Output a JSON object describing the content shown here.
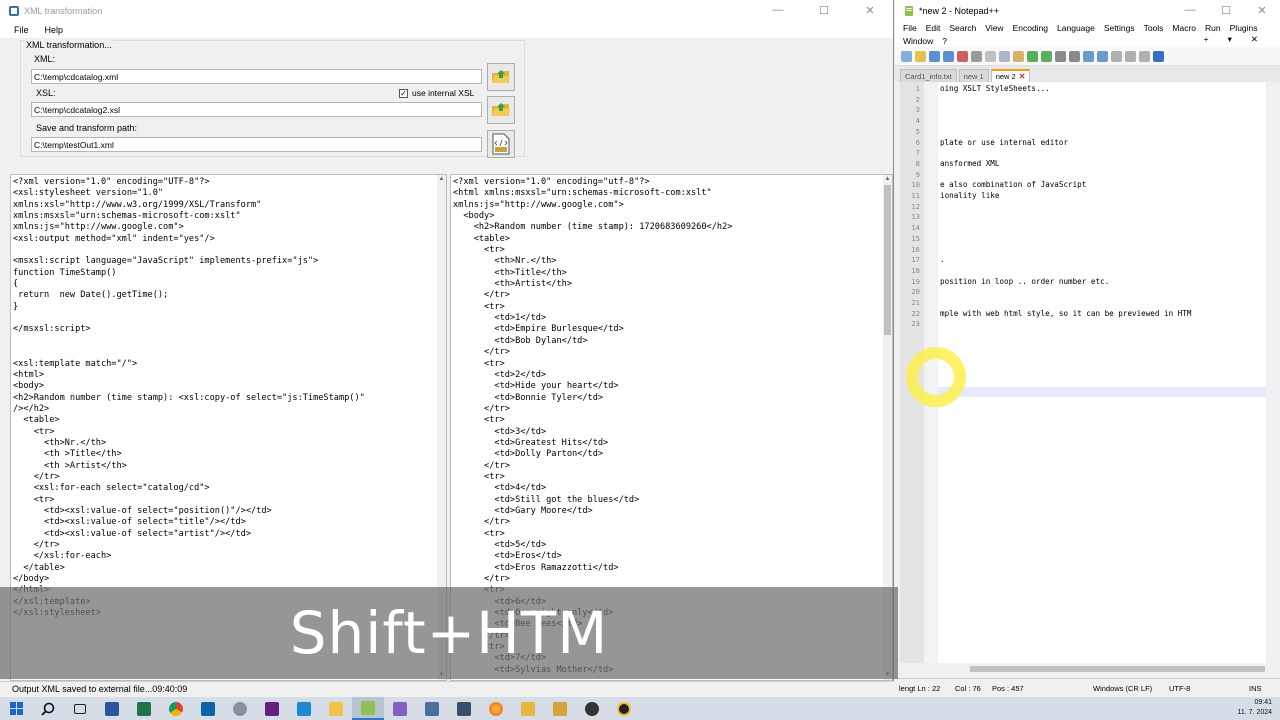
{
  "xml_window": {
    "title": "XML transformation",
    "menu": [
      "File",
      "Help"
    ],
    "group_title": "XML transformation...",
    "xml_label": "XML:",
    "xml_value": "C:\\temp\\cdcatalog.xml",
    "xsl_label": "XSL:",
    "xsl_value": "C:\\temp\\cdcatalog2.xsl",
    "use_internal_label": "use internal XSL",
    "use_internal_checked": true,
    "save_label": "Save and transform path:",
    "save_value": "C:\\temp\\testOut1.xml",
    "xsl_source": "<?xml version=\"1.0\" encoding=\"UTF-8\"?>\n<xsl:stylesheet version=\"1.0\"\nxmlns:xsl=\"http://www.w3.org/1999/XSL/Transform\"\nxmlns:msxsl=\"urn:schemas-microsoft-com:xslt\"\nxmlns:js=\"http://www.google.com\">\n<xsl:output method=\"xml\" indent=\"yes\"/>\n\n<msxsl:script language=\"JavaScript\" implements-prefix=\"js\">\nfunction TimeStamp()\n{\n return  new Date().getTime();\n}\n\n</msxsl:script>\n\n\n<xsl:template match=\"/\">\n<html>\n<body>\n<h2>Random number (time stamp): <xsl:copy-of select=\"js:TimeStamp()\"\n/></h2>\n  <table>\n    <tr>\n      <th>Nr.</th>\n      <th >Title</th>\n      <th >Artist</th>\n    </tr>\n    <xsl:for-each select=\"catalog/cd\">\n    <tr>\n      <td><xsl:value-of select=\"position()\"/></td>\n      <td><xsl:value-of select=\"title\"/></td>\n      <td><xsl:value-of select=\"artist\"/></td>\n    </tr>\n    </xsl:for-each>\n  </table>\n</body>\n</html>\n</xsl:template>\n</xsl:stylesheet>",
    "output_source": "<?xml version=\"1.0\" encoding=\"utf-8\"?>\n<html xmlns:msxsl=\"urn:schemas-microsoft-com:xslt\"\nxmlns:js=\"http://www.google.com\">\n  <body>\n    <h2>Random number (time stamp): 1720683609260</h2>\n    <table>\n      <tr>\n        <th>Nr.</th>\n        <th>Title</th>\n        <th>Artist</th>\n      </tr>\n      <tr>\n        <td>1</td>\n        <td>Empire Burlesque</td>\n        <td>Bob Dylan</td>\n      </tr>\n      <tr>\n        <td>2</td>\n        <td>Hide your heart</td>\n        <td>Bonnie Tyler</td>\n      </tr>\n      <tr>\n        <td>3</td>\n        <td>Greatest Hits</td>\n        <td>Dolly Parton</td>\n      </tr>\n      <tr>\n        <td>4</td>\n        <td>Still got the blues</td>\n        <td>Gary Moore</td>\n      </tr>\n      <tr>\n        <td>5</td>\n        <td>Eros</td>\n        <td>Eros Ramazzotti</td>\n      </tr>\n      <tr>\n        <td>6</td>\n        <td>One night only</td>\n        <td>Bee Gees</td>\n      </tr>\n      <tr>\n        <td>7</td>\n        <td>Sylvias Mother</td>",
    "status": "Output XML saved to external file...09:40:09"
  },
  "notepad": {
    "title": "*new 2 - Notepad++",
    "menu_row1": [
      "File",
      "Edit",
      "Search",
      "View",
      "Encoding",
      "Language",
      "Settings",
      "Tools",
      "Macro",
      "Run",
      "Plugins"
    ],
    "menu_row2": [
      "Window",
      "?"
    ],
    "menu_right": [
      "+",
      "▾",
      "✕"
    ],
    "tabs": [
      {
        "label": "Card1_info.txt",
        "active": false
      },
      {
        "label": "new 1",
        "active": false
      },
      {
        "label": "new 2",
        "active": true
      }
    ],
    "lines": [
      {
        "n": "1",
        "t": "oing XSLT StyleSheets..."
      },
      {
        "n": "2",
        "t": ""
      },
      {
        "n": "3",
        "t": ""
      },
      {
        "n": "4",
        "t": ""
      },
      {
        "n": "5",
        "t": ""
      },
      {
        "n": "6",
        "t": "plate or use internal editor"
      },
      {
        "n": "7",
        "t": ""
      },
      {
        "n": "8",
        "t": "ansformed XML"
      },
      {
        "n": "9",
        "t": ""
      },
      {
        "n": "10",
        "t": "e also combination of JavaScript"
      },
      {
        "n": "11",
        "t": "ionality like"
      },
      {
        "n": "12",
        "t": ""
      },
      {
        "n": "13",
        "t": ""
      },
      {
        "n": "14",
        "t": ""
      },
      {
        "n": "15",
        "t": ""
      },
      {
        "n": "16",
        "t": ""
      },
      {
        "n": "17",
        "t": "."
      },
      {
        "n": "18",
        "t": ""
      },
      {
        "n": "19",
        "t": "position in loop .. order number etc."
      },
      {
        "n": "20",
        "t": ""
      },
      {
        "n": "21",
        "t": ""
      },
      {
        "n": "22",
        "t": "mple with web html style, so it can be previewed in HTM"
      },
      {
        "n": "23",
        "t": ""
      }
    ],
    "status_length": "lengt Ln : 22",
    "status_col": "Col : 76",
    "status_pos": "Pos : 457",
    "status_eol": "Windows (CR LF)",
    "status_enc": "UTF-8",
    "status_ins": "INS"
  },
  "overlay_text": "Shift+HTM",
  "taskbar": {
    "time": "09:41",
    "date": "11. 7. 2024"
  }
}
